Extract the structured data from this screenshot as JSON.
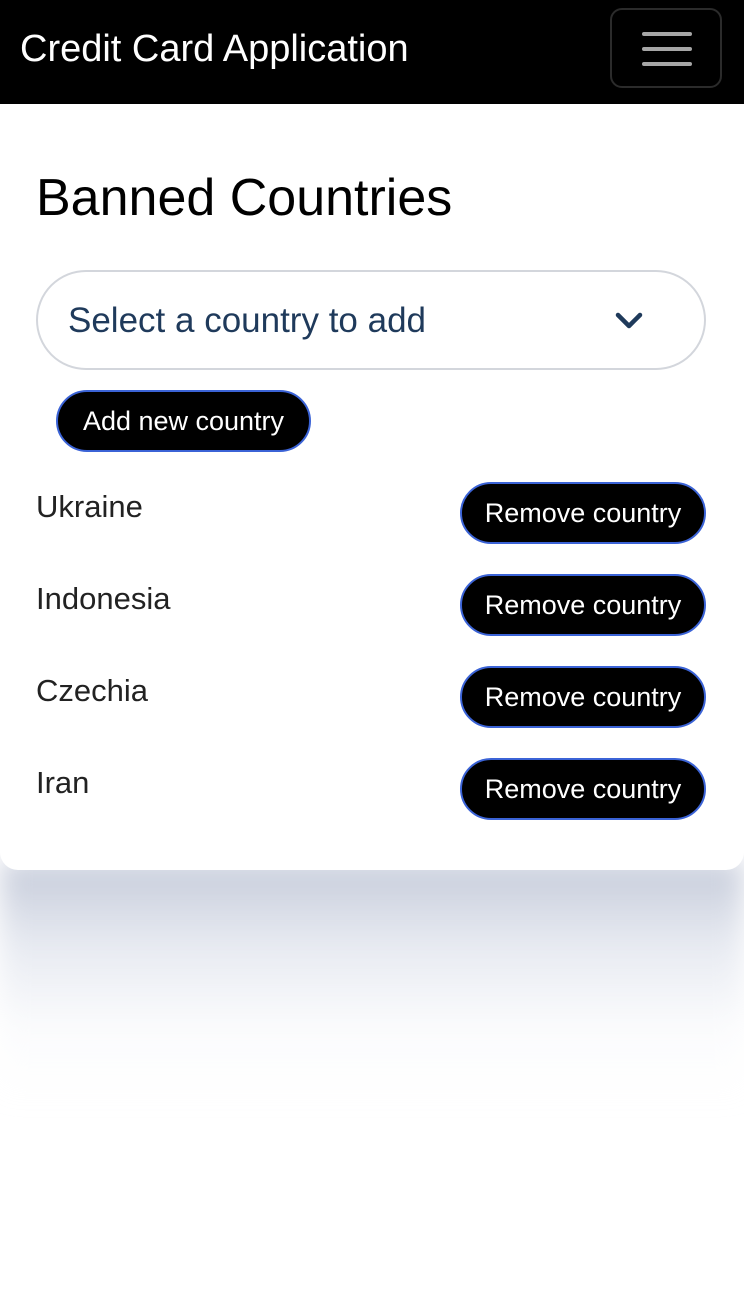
{
  "navbar": {
    "brand": "Credit Card Application",
    "menu_icon": "hamburger-menu-icon"
  },
  "main": {
    "title": "Banned Countries",
    "select": {
      "placeholder": "Select a country to add",
      "icon": "chevron-down-icon"
    },
    "add_button_label": "Add new country",
    "countries": [
      {
        "name": "Ukraine",
        "remove_label": "Remove country"
      },
      {
        "name": "Indonesia",
        "remove_label": "Remove country"
      },
      {
        "name": "Czechia",
        "remove_label": "Remove country"
      },
      {
        "name": "Iran",
        "remove_label": "Remove country"
      }
    ]
  },
  "colors": {
    "navbar_background": "#000000",
    "button_background": "#000000",
    "button_border": "#3b63d6",
    "select_text": "#1f3a5b",
    "page_background": "#ffffff"
  }
}
